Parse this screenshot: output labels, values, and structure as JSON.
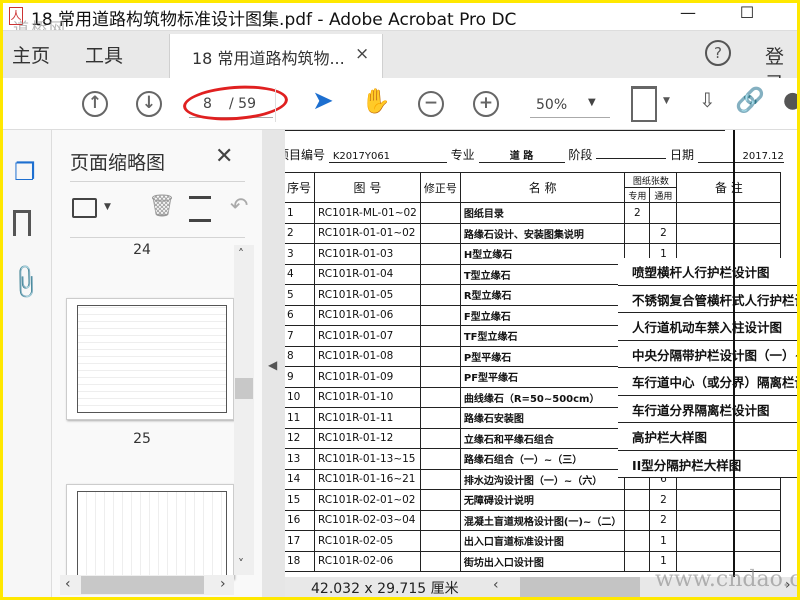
{
  "window": {
    "title": "18 常用道路构筑物标准设计图集.pdf - Adobe Acrobat Pro DC",
    "minimize": "—",
    "maximize": "☐"
  },
  "watermark": {
    "top": "道桥网",
    "bottom": "www.cndao.com"
  },
  "tabs": {
    "home": "主页",
    "tools": "工具",
    "document": "18 常用道路构筑物...",
    "close": "×",
    "help": "?",
    "login": "登录"
  },
  "toolbar": {
    "current_page": "8",
    "total_pages": "/ 59",
    "zoom": "50%"
  },
  "panel": {
    "title": "页面缩略图",
    "close": "✕",
    "pages": [
      "24",
      "25"
    ]
  },
  "document": {
    "project_no_label": "项目编号",
    "project_no": "K2017Y061",
    "major_label": "专业",
    "major": "道 路",
    "stage_label": "阶段",
    "stage": "",
    "date_label": "日期",
    "date": "2017.12",
    "headers": {
      "seq": "序号",
      "drawing_no": "图 号",
      "revision": "修正号",
      "name": "名 称",
      "sheets": "图纸张数",
      "dedicated": "专用",
      "general": "通用",
      "remarks": "备 注"
    },
    "rows": [
      {
        "n": "1",
        "no": "RC101R-ML-01~02",
        "name": "图纸目录",
        "d": "2",
        "g": ""
      },
      {
        "n": "2",
        "no": "RC101R-01-01~02",
        "name": "路缘石设计、安装图集说明",
        "d": "",
        "g": "2"
      },
      {
        "n": "3",
        "no": "RC101R-01-03",
        "name": "H型立缘石",
        "d": "",
        "g": "1"
      },
      {
        "n": "4",
        "no": "RC101R-01-04",
        "name": "T型立缘石",
        "d": "",
        "g": ""
      },
      {
        "n": "5",
        "no": "RC101R-01-05",
        "name": "R型立缘石",
        "d": "",
        "g": ""
      },
      {
        "n": "6",
        "no": "RC101R-01-06",
        "name": "F型立缘石",
        "d": "",
        "g": ""
      },
      {
        "n": "7",
        "no": "RC101R-01-07",
        "name": "TF型立缘石",
        "d": "",
        "g": ""
      },
      {
        "n": "8",
        "no": "RC101R-01-08",
        "name": "P型平缘石",
        "d": "",
        "g": ""
      },
      {
        "n": "9",
        "no": "RC101R-01-09",
        "name": "PF型平缘石",
        "d": "",
        "g": ""
      },
      {
        "n": "10",
        "no": "RC101R-01-10",
        "name": "曲线缘石（R=50~500cm）",
        "d": "",
        "g": ""
      },
      {
        "n": "11",
        "no": "RC101R-01-11",
        "name": "路缘石安装图",
        "d": "",
        "g": ""
      },
      {
        "n": "12",
        "no": "RC101R-01-12",
        "name": "立缘石和平缘石组合",
        "d": "",
        "g": ""
      },
      {
        "n": "13",
        "no": "RC101R-01-13~15",
        "name": "路缘石组合（一）~（三）",
        "d": "",
        "g": ""
      },
      {
        "n": "14",
        "no": "RC101R-01-16~21",
        "name": "排水边沟设计图（一）~（六）",
        "d": "",
        "g": "6"
      },
      {
        "n": "15",
        "no": "RC101R-02-01~02",
        "name": "无障碍设计说明",
        "d": "",
        "g": "2"
      },
      {
        "n": "16",
        "no": "RC101R-02-03~04",
        "name": "混凝土盲道规格设计图(一)~（二）",
        "d": "",
        "g": "2"
      },
      {
        "n": "17",
        "no": "RC101R-02-05",
        "name": "出入口盲道标准设计图",
        "d": "",
        "g": "1"
      },
      {
        "n": "18",
        "no": "RC101R-02-06",
        "name": "街坊出入口设计图",
        "d": "",
        "g": "1"
      }
    ],
    "overlay": [
      "喷塑横杆人行护栏设计图",
      "不锈钢复合管横杆式人行护栏设计图",
      "人行道机动车禁入柱设计图",
      "中央分隔带护栏设计图（一）~（二）",
      "车行道中心（或分界）隔离栏设计图",
      "车行道分界隔离栏设计图",
      "高护栏大样图",
      "II型分隔护栏大样图"
    ]
  },
  "status": {
    "page_size": "42.032 x 29.715 厘米"
  }
}
